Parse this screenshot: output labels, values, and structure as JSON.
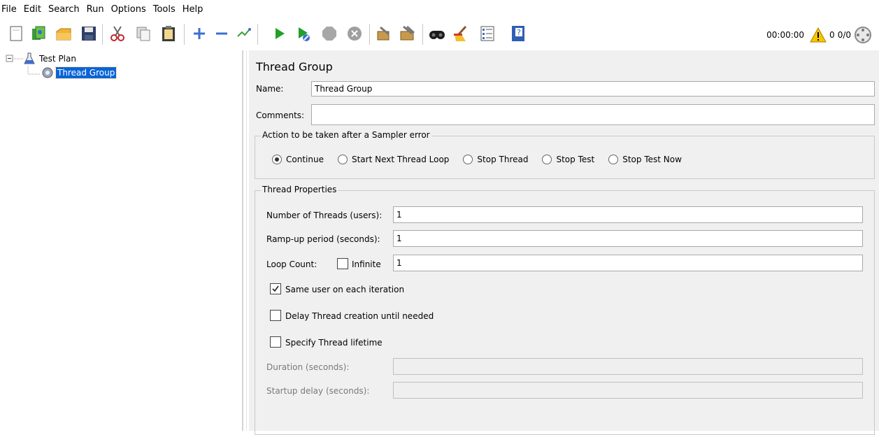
{
  "menubar": {
    "items": [
      "File",
      "Edit",
      "Search",
      "Run",
      "Options",
      "Tools",
      "Help"
    ]
  },
  "toolbar": {
    "icons": [
      "new-icon",
      "templates-icon",
      "open-icon",
      "save-icon",
      "cut-icon",
      "copy-icon",
      "paste-icon",
      "expand-icon",
      "collapse-icon",
      "toggle-icon",
      "start-icon",
      "start-no-pauses-icon",
      "stop-icon",
      "shutdown-icon",
      "clear-icon",
      "clear-all-icon",
      "search-icon",
      "reset-search-icon",
      "function-helper-icon",
      "help-icon"
    ]
  },
  "status": {
    "timer": "00:00:00",
    "warning_count": "0",
    "threads": "0/0"
  },
  "tree": {
    "root": "Test Plan",
    "child": "Thread Group"
  },
  "panel": {
    "title": "Thread Group",
    "name_label": "Name:",
    "name_value": "Thread Group",
    "comments_label": "Comments:",
    "comments_value": "",
    "error_section": {
      "legend": "Action to be taken after a Sampler error",
      "options": [
        "Continue",
        "Start Next Thread Loop",
        "Stop Thread",
        "Stop Test",
        "Stop Test Now"
      ],
      "selected": "Continue"
    },
    "thread_props": {
      "legend": "Thread Properties",
      "threads_label": "Number of Threads (users):",
      "threads_value": "1",
      "rampup_label": "Ramp-up period (seconds):",
      "rampup_value": "1",
      "loop_label": "Loop Count:",
      "infinite_label": "Infinite",
      "loop_value": "1",
      "same_user_label": "Same user on each iteration",
      "delay_label": "Delay Thread creation until needed",
      "lifetime_label": "Specify Thread lifetime",
      "duration_label": "Duration (seconds):",
      "duration_value": "",
      "startup_label": "Startup delay (seconds):",
      "startup_value": ""
    }
  },
  "colors": {
    "selection": "#0a64d8",
    "panel_bg": "#f0f0f0",
    "play_green": "#22a02a",
    "warning_yellow": "#f7c600"
  }
}
